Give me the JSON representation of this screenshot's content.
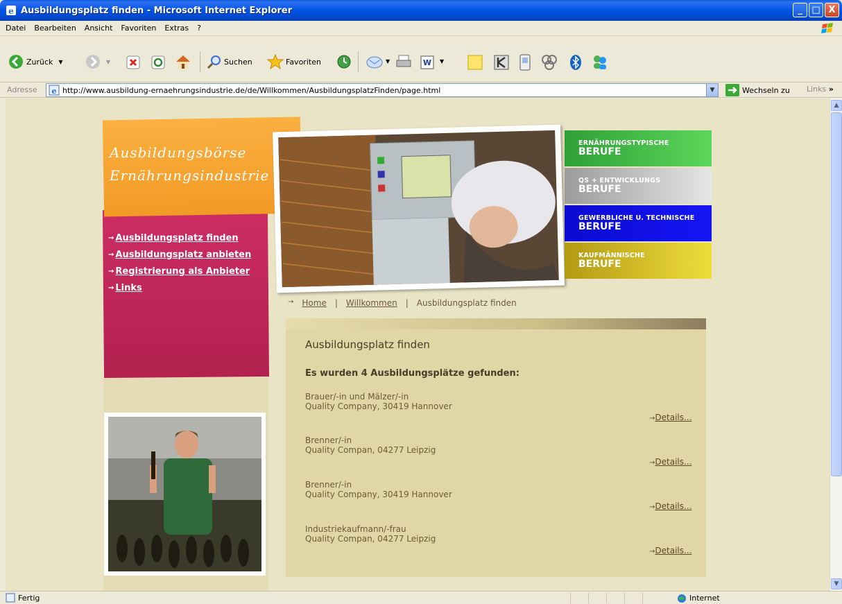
{
  "window": {
    "title": "Ausbildungsplatz finden - Microsoft Internet Explorer",
    "minimize": "_",
    "maximize": "□",
    "close": "X"
  },
  "menu": [
    "Datei",
    "Bearbeiten",
    "Ansicht",
    "Favoriten",
    "Extras",
    "?"
  ],
  "toolbar": {
    "back": "Zurück",
    "search": "Suchen",
    "favorites": "Favoriten"
  },
  "address": {
    "label": "Adresse",
    "url": "http://www.ausbildung-ernaehrungsindustrie.de/de/Willkommen/AusbildungsplatzFinden/page.html",
    "go": "Wechseln zu",
    "links": "Links"
  },
  "page": {
    "brand_line1": "Ausbildungsbörse",
    "brand_line2": "Ernährungsindustrie",
    "nav": [
      "Ausbildungsplatz finden",
      "Ausbildungsplatz anbieten",
      "Registrierung als Anbieter",
      "Links"
    ],
    "categories": [
      {
        "small": "ERNÄHRUNGSTYPISCHE",
        "big": "BERUFE",
        "color": "#3cb043"
      },
      {
        "small": "QS + ENTWICKLUNGS",
        "big": "BERUFE",
        "color": "#b3b3b3"
      },
      {
        "small": "GEWERBLICHE U. TECHNISCHE",
        "big": "BERUFE",
        "color": "#0d0de6"
      },
      {
        "small": "KAUFMÄNNISCHE",
        "big": "BERUFE",
        "color": "#c8b21e"
      }
    ],
    "breadcrumb": [
      "Home",
      "|",
      "Willkommen",
      "|",
      "Ausbildungsplatz finden"
    ],
    "heading": "Ausbildungsplatz finden",
    "result_count": "Es wurden 4 Ausbildungsplätze gefunden:",
    "details_label": "Details...",
    "results": [
      {
        "title": "Brauer/-in und Mälzer/-in",
        "company": "Quality Company, 30419 Hannover"
      },
      {
        "title": "Brenner/-in",
        "company": "Quality Compan, 04277 Leipzig"
      },
      {
        "title": "Brenner/-in",
        "company": "Quality Company, 30419 Hannover"
      },
      {
        "title": "Industriekaufmann/-frau",
        "company": "Quality Compan, 04277 Leipzig"
      }
    ]
  },
  "status": {
    "text": "Fertig",
    "zone": "Internet"
  }
}
